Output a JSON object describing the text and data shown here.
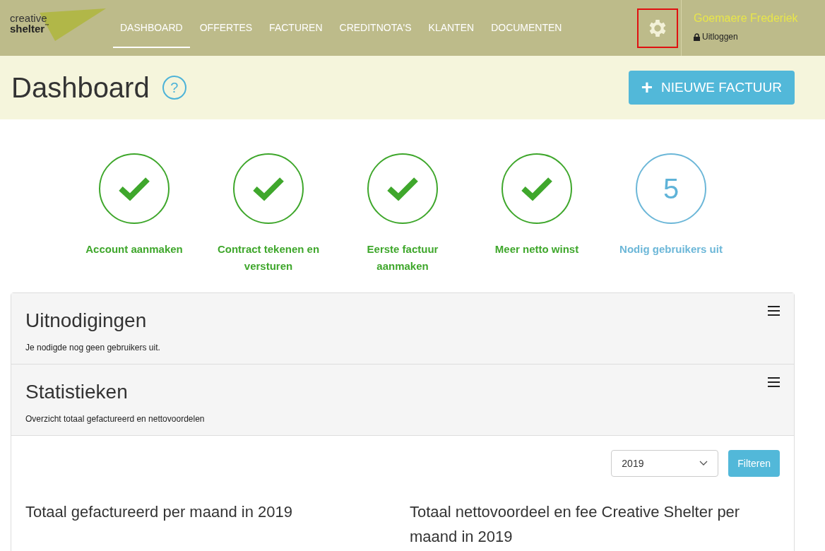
{
  "header": {
    "logo": {
      "line1": "creative",
      "line2": "shelter",
      "tm": "™"
    },
    "nav": [
      {
        "label": "DASHBOARD",
        "selected": true
      },
      {
        "label": "OFFERTES",
        "selected": false
      },
      {
        "label": "FACTUREN",
        "selected": false
      },
      {
        "label": "CREDITNOTA'S",
        "selected": false
      },
      {
        "label": "KLANTEN",
        "selected": false
      },
      {
        "label": "DOCUMENTEN",
        "selected": false
      }
    ],
    "settings": {
      "highlighted": true
    },
    "user": {
      "name": "Goemaere Frederiek",
      "logout": "Uitloggen"
    }
  },
  "page": {
    "title": "Dashboard",
    "help": "?",
    "new_button": {
      "icon": "+",
      "label": "NIEUWE FACTUUR"
    }
  },
  "steps": [
    {
      "kind": "done",
      "label": "Account aanmaken"
    },
    {
      "kind": "done",
      "label": "Contract tekenen en versturen"
    },
    {
      "kind": "done",
      "label": "Eerste factuur aanmaken"
    },
    {
      "kind": "done",
      "label": "Meer netto winst"
    },
    {
      "kind": "count",
      "value": "5",
      "label": "Nodig gebruikers uit"
    }
  ],
  "panels": [
    {
      "title": "Uitnodigingen",
      "subtitle": "Je nodigde nog geen gebruikers uit."
    },
    {
      "title": "Statistieken",
      "subtitle": "Overzicht totaal gefactureerd en nettovoordelen"
    }
  ],
  "stats": {
    "year": "2019",
    "filter": "Filteren",
    "chart_titles": [
      "Totaal gefactureerd per maand in 2019",
      "Totaal nettovoordeel en fee Creative Shelter per maand in 2019"
    ]
  }
}
